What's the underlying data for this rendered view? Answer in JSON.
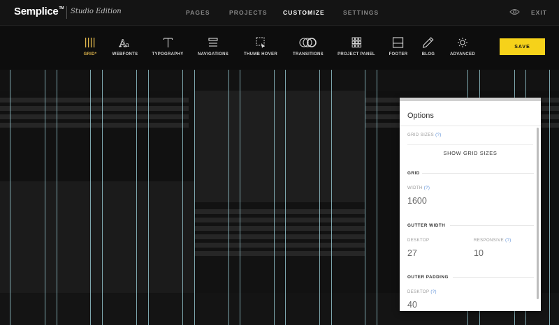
{
  "brand": {
    "name": "Semplice",
    "tm": "TM",
    "edition": "Studio Edition"
  },
  "main_nav": [
    {
      "label": "PAGES",
      "active": false
    },
    {
      "label": "PROJECTS",
      "active": false
    },
    {
      "label": "CUSTOMIZE",
      "active": true
    },
    {
      "label": "SETTINGS",
      "active": false
    }
  ],
  "exit_label": "EXIT",
  "preview_icon": "eye-icon",
  "toolbar": {
    "tools": [
      {
        "label": "GRID*",
        "icon": "grid-columns-icon",
        "active": true
      },
      {
        "label": "WEBFONTS",
        "icon": "webfonts-icon",
        "active": false
      },
      {
        "label": "TYPOGRAPHY",
        "icon": "typography-icon",
        "active": false
      },
      {
        "label": "NAVIGATIONS",
        "icon": "navigations-icon",
        "active": false
      },
      {
        "label": "THUMB HOVER",
        "icon": "thumb-hover-icon",
        "active": false
      },
      {
        "label": "TRANSITIONS",
        "icon": "transitions-icon",
        "active": false
      },
      {
        "label": "PROJECT PANEL",
        "icon": "project-panel-icon",
        "active": false
      },
      {
        "label": "FOOTER",
        "icon": "footer-icon",
        "active": false
      },
      {
        "label": "BLOG",
        "icon": "pencil-icon",
        "active": false
      },
      {
        "label": "ADVANCED",
        "icon": "sun-gear-icon",
        "active": false
      }
    ],
    "save_label": "SAVE"
  },
  "options": {
    "title": "Options",
    "grid_sizes_label": "GRID SIZES",
    "help_mark": "(?)",
    "show_grid_sizes": "SHOW GRID SIZES",
    "grid_heading": "GRID",
    "width_label": "WIDTH",
    "width_value": "1600",
    "gutter_heading": "GUTTER WIDTH",
    "desktop_label": "DESKTOP",
    "responsive_label": "RESPONSIVE",
    "gutter_desktop_value": "27",
    "gutter_responsive_value": "10",
    "outer_padding_heading": "OUTER PADDING",
    "outer_desktop_label": "DESKTOP",
    "outer_desktop_value": "40"
  },
  "colors": {
    "accent_save": "#f6d21a",
    "active_tool": "#e0b64c",
    "grid_line": "#8fc0c8",
    "help_link": "#5b8fd8"
  }
}
